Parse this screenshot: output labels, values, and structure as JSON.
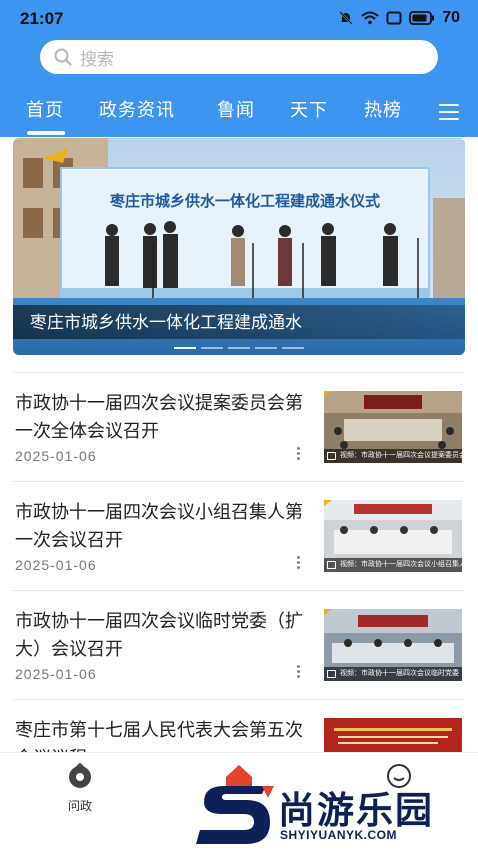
{
  "status_bar": {
    "time": "21:07",
    "battery": "70"
  },
  "search": {
    "placeholder": "搜索"
  },
  "tabs": [
    {
      "label": "首页",
      "active": true
    },
    {
      "label": "政务资讯"
    },
    {
      "label": "鲁闻"
    },
    {
      "label": "天下"
    },
    {
      "label": "热榜"
    }
  ],
  "banner": {
    "caption": "枣庄市城乡供水一体化工程建成通水",
    "backdrop_text": "枣庄市城乡供水一体化工程建成通水仪式",
    "slides": 5,
    "active_slide": 1
  },
  "news": [
    {
      "title": "市政协十一届四次会议提案委员会第一次全体会议召开",
      "date": "2025-01-06",
      "thumb_caption": "视频：市政协十一届四次会议提案委员会..."
    },
    {
      "title": "市政协十一届四次会议小组召集人第一次会议召开",
      "date": "2025-01-06",
      "thumb_caption": "视频：市政协十一届四次会议小组召集人..."
    },
    {
      "title": "市政协十一届四次会议临时党委（扩大）会议召开",
      "date": "2025-01-06",
      "thumb_caption": "视频：市政协十一届四次会议临时党委（扩..."
    },
    {
      "title": "枣庄市第十七届人民代表大会第五次会议议程",
      "date": "",
      "thumb_caption": ""
    }
  ],
  "bottom_nav": {
    "wenzheng_label": "问政"
  },
  "watermark": {
    "text": "尚游乐园",
    "url": "SHYIYUANYK.COM"
  },
  "colors": {
    "header_blue": "#3d95f0",
    "watermark_navy": "#0f1f57"
  }
}
